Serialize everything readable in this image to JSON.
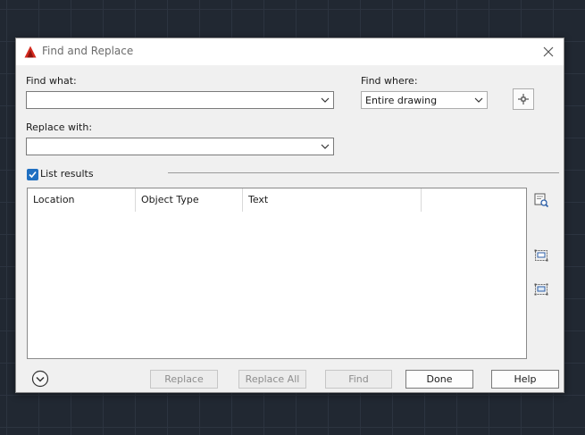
{
  "dialog": {
    "title": "Find and Replace",
    "app_icon": "autocad-logo-icon",
    "close_icon": "close-icon"
  },
  "find_what": {
    "label": "Find what:",
    "value": ""
  },
  "find_where": {
    "label": "Find where:",
    "value": "Entire drawing",
    "pick_icon": "select-objects-icon"
  },
  "replace_with": {
    "label": "Replace with:",
    "value": ""
  },
  "list_results": {
    "label": "List results",
    "checked": true
  },
  "results_table": {
    "columns": [
      "Location",
      "Object Type",
      "Text",
      ""
    ],
    "rows": []
  },
  "side_tools": [
    "zoom-to-highlighted-icon",
    "create-selection-set-highlighted-icon",
    "create-selection-set-all-icon"
  ],
  "buttons": {
    "more_options_icon": "chevron-down-icon",
    "replace": "Replace",
    "replace_all": "Replace All",
    "find": "Find",
    "done": "Done",
    "help": "Help"
  },
  "colors": {
    "accent": "#1f6fc1",
    "brand": "#d42a1f",
    "background": "#212832",
    "dialog": "#f0f0f0"
  }
}
